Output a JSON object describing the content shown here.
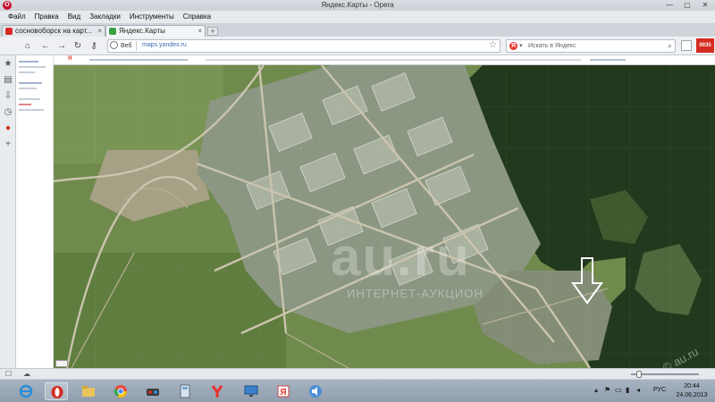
{
  "window": {
    "title": "Яндекс.Карты - Opera",
    "logo_letter": "O",
    "controls": [
      "—",
      "▢",
      "✕"
    ]
  },
  "menu": [
    "Файл",
    "Правка",
    "Вид",
    "Закладки",
    "Инструменты",
    "Справка"
  ],
  "tabs": [
    {
      "label": "сосновоборск на карт...",
      "favicon_color": "#d62b20",
      "active": false
    },
    {
      "label": "Яндекс.Карты",
      "favicon_color": "#3aa040",
      "active": true
    }
  ],
  "new_tab_label": "+",
  "addressbar": {
    "badge": "Веб",
    "url": "maps.yandex.ru"
  },
  "search": {
    "engine_letter": "Я",
    "placeholder": "Искать в Яндекс"
  },
  "extension_badge": "0035",
  "map": {
    "watermark": "au.ru",
    "watermark_sub": "ИНТЕРНЕТ-АУКЦИОН",
    "watermark_corner": "© au.ru",
    "colors": {
      "field": "#6f8a4c",
      "forest": "#223a1e",
      "urban": "#8e9a83",
      "road": "#c9c2ad",
      "arrow": "#ffffff"
    }
  },
  "taskbar": {
    "apps": [
      "ie-icon",
      "opera-icon",
      "explorer-icon",
      "chrome-icon",
      "game-icon",
      "calculator-icon",
      "yandex-icon",
      "remote-icon",
      "yandex-browser-icon",
      "speaker-app-icon"
    ],
    "language": "РУС",
    "time": "20:44",
    "date": "24.06.2013"
  }
}
